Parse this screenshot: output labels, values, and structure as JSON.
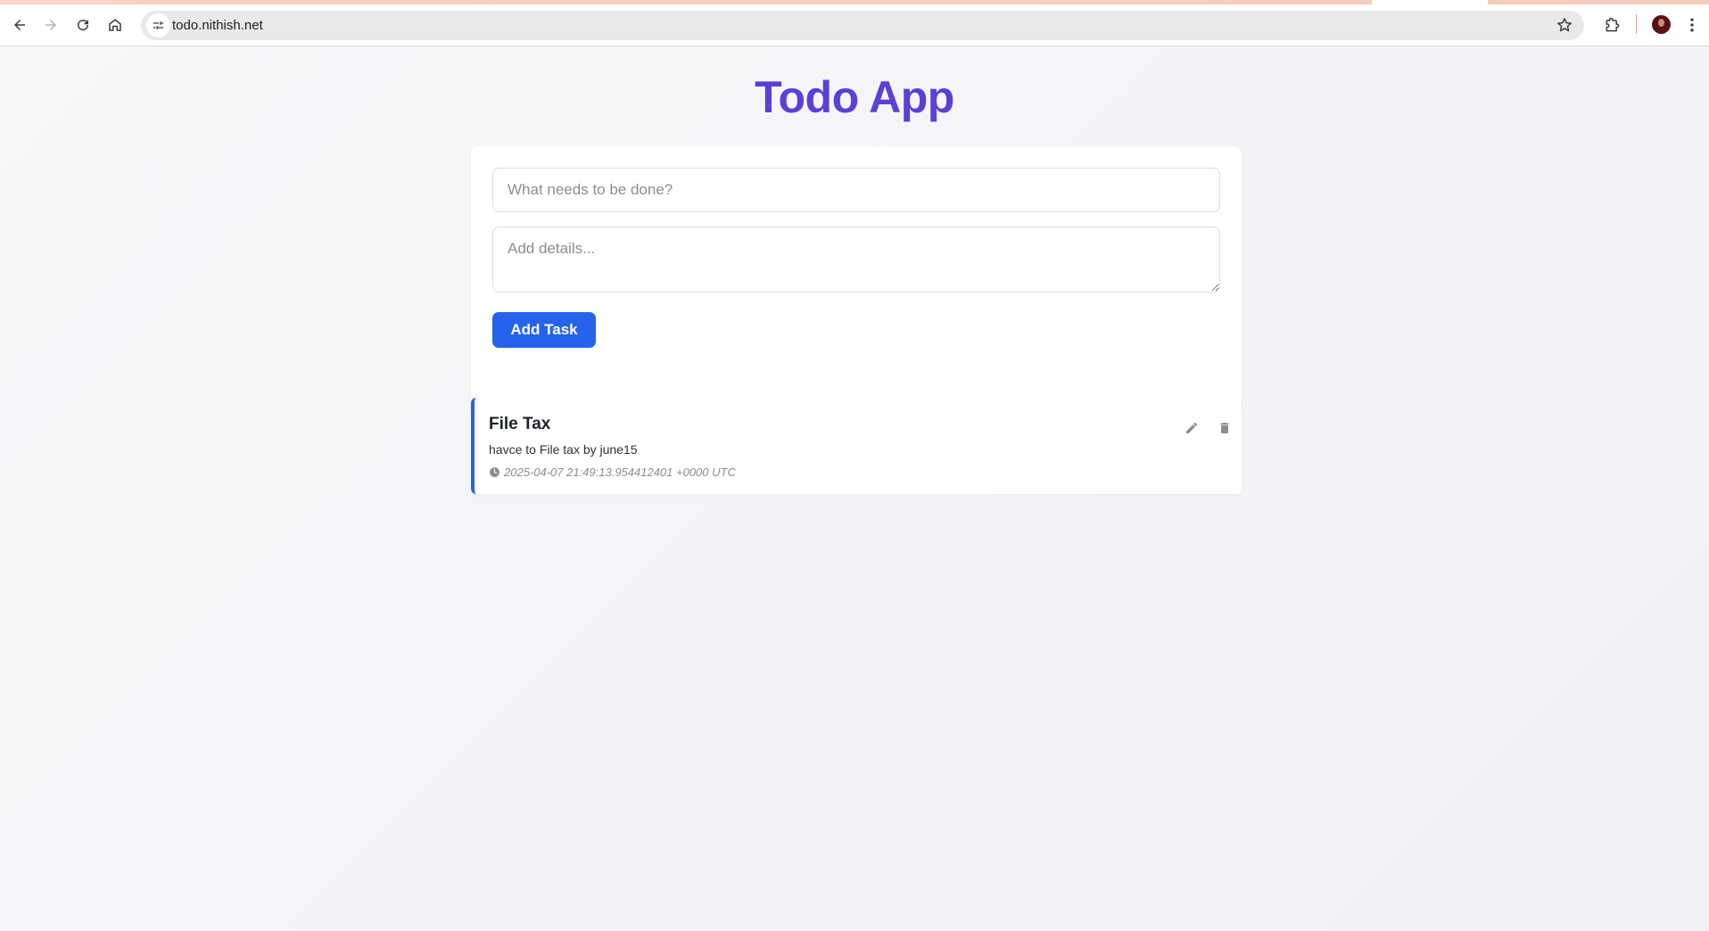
{
  "browser": {
    "url": "todo.nithish.net",
    "icons": {
      "back": "back-arrow-icon",
      "forward": "forward-arrow-icon",
      "reload": "reload-icon",
      "home": "home-icon",
      "site_info": "tune-icon",
      "bookmark": "star-icon",
      "extensions": "puzzle-icon",
      "menu": "kebab-menu-icon"
    }
  },
  "app": {
    "title": "Todo App",
    "accent_color": "#5b3fd6",
    "button_color": "#2563eb"
  },
  "form": {
    "task_placeholder": "What needs to be done?",
    "task_value": "",
    "details_placeholder": "Add details...",
    "details_value": "",
    "add_button_label": "Add Task"
  },
  "tasks": [
    {
      "title": "File Tax",
      "description": "havce to File tax by june15",
      "timestamp": "2025-04-07 21:49:13.954412401 +0000 UTC",
      "icons": {
        "edit": "pencil-icon",
        "delete": "trash-icon",
        "time": "clock-icon"
      }
    }
  ]
}
